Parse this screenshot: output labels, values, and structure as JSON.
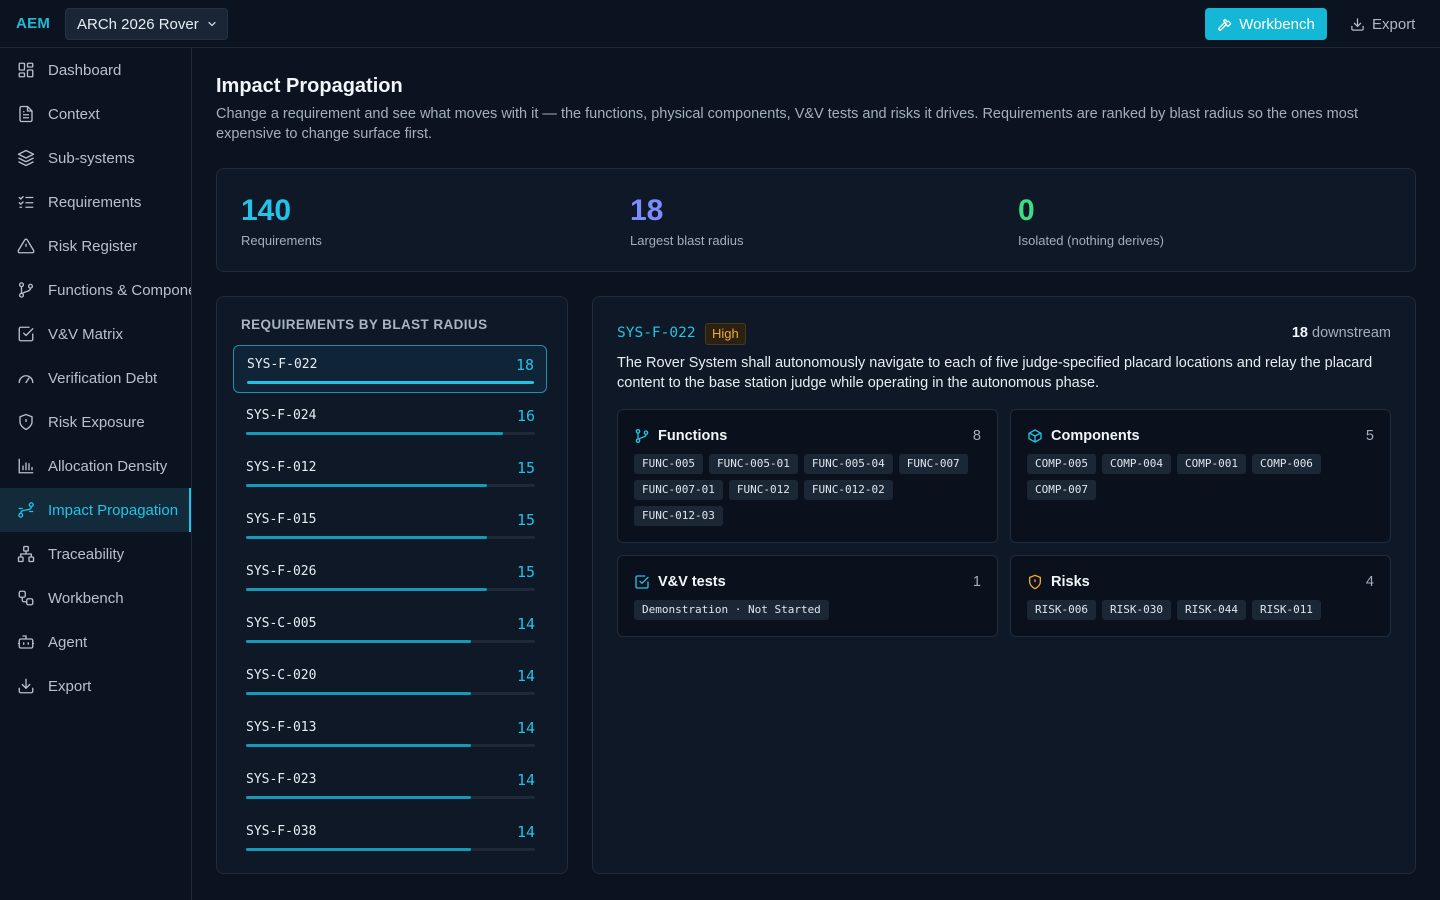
{
  "brand": "AEM",
  "project": {
    "name": "ARCh 2026 Rover"
  },
  "topbar": {
    "workbench_label": "Workbench",
    "export_label": "Export"
  },
  "sidebar": {
    "items": [
      {
        "label": "Dashboard",
        "icon": "dashboard-icon"
      },
      {
        "label": "Context",
        "icon": "document-icon"
      },
      {
        "label": "Sub-systems",
        "icon": "layers-icon"
      },
      {
        "label": "Requirements",
        "icon": "checklist-icon"
      },
      {
        "label": "Risk Register",
        "icon": "warning-icon"
      },
      {
        "label": "Functions & Components",
        "icon": "branch-icon"
      },
      {
        "label": "V&V Matrix",
        "icon": "check-square-icon"
      },
      {
        "label": "Verification Debt",
        "icon": "gauge-icon"
      },
      {
        "label": "Risk Exposure",
        "icon": "shield-icon"
      },
      {
        "label": "Allocation Density",
        "icon": "bar-chart-icon"
      },
      {
        "label": "Impact Propagation",
        "icon": "spline-icon",
        "active": true
      },
      {
        "label": "Traceability",
        "icon": "network-icon"
      },
      {
        "label": "Workbench",
        "icon": "workflow-icon"
      },
      {
        "label": "Agent",
        "icon": "bot-icon"
      },
      {
        "label": "Export",
        "icon": "download-icon"
      }
    ]
  },
  "page": {
    "title": "Impact Propagation",
    "description": "Change a requirement and see what moves with it — the functions, physical components, V&V tests and risks it drives. Requirements are ranked by blast radius so the ones most expensive to change surface first."
  },
  "stats": [
    {
      "value": "140",
      "label": "Requirements",
      "color": "#22c3e6"
    },
    {
      "value": "18",
      "label": "Largest blast radius",
      "color": "#7b8cff"
    },
    {
      "value": "0",
      "label": "Isolated (nothing derives)",
      "color": "#3ddc84"
    }
  ],
  "list": {
    "title": "REQUIREMENTS BY BLAST RADIUS",
    "max": 18,
    "items": [
      {
        "id": "SYS-F-022",
        "count": 18,
        "selected": true
      },
      {
        "id": "SYS-F-024",
        "count": 16
      },
      {
        "id": "SYS-F-012",
        "count": 15
      },
      {
        "id": "SYS-F-015",
        "count": 15
      },
      {
        "id": "SYS-F-026",
        "count": 15
      },
      {
        "id": "SYS-C-005",
        "count": 14
      },
      {
        "id": "SYS-C-020",
        "count": 14
      },
      {
        "id": "SYS-F-013",
        "count": 14
      },
      {
        "id": "SYS-F-023",
        "count": 14
      },
      {
        "id": "SYS-F-038",
        "count": 14
      }
    ]
  },
  "detail": {
    "id": "SYS-F-022",
    "priority": "High",
    "downstream_count": "18",
    "downstream_label": "downstream",
    "text": "The Rover System shall autonomously navigate to each of five judge-specified placard locations and relay the placard content to the base station judge while operating in the autonomous phase.",
    "cards": {
      "functions": {
        "title": "Functions",
        "count": "8",
        "tags": [
          "FUNC-005",
          "FUNC-005-01",
          "FUNC-005-04",
          "FUNC-007",
          "FUNC-007-01",
          "FUNC-012",
          "FUNC-012-02",
          "FUNC-012-03"
        ]
      },
      "components": {
        "title": "Components",
        "count": "5",
        "tags": [
          "COMP-005",
          "COMP-004",
          "COMP-001",
          "COMP-006",
          "COMP-007"
        ]
      },
      "vv": {
        "title": "V&V tests",
        "count": "1",
        "tags": [
          "Demonstration · Not Started"
        ]
      },
      "risks": {
        "title": "Risks",
        "count": "4",
        "tags": [
          "RISK-006",
          "RISK-030",
          "RISK-044",
          "RISK-011"
        ]
      }
    }
  }
}
